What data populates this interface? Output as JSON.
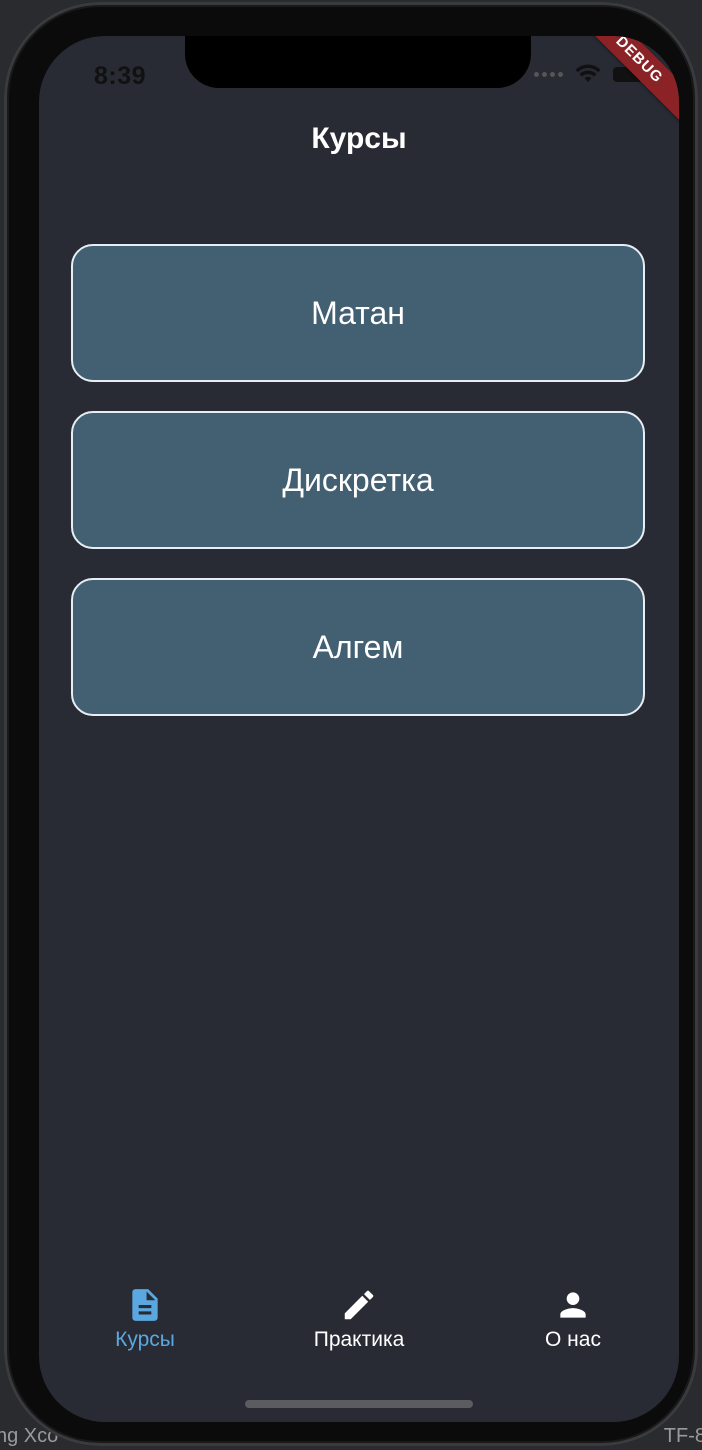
{
  "host": {
    "left_text": "ng Xco",
    "right_text": "TF-8"
  },
  "status_bar": {
    "time": "8:39",
    "debug_label": "DEBUG"
  },
  "app": {
    "title": "Курсы"
  },
  "courses": [
    {
      "label": "Матан"
    },
    {
      "label": "Дискретка"
    },
    {
      "label": "Алгем"
    }
  ],
  "bottom_nav": {
    "items": [
      {
        "label": "Курсы",
        "icon": "document-icon",
        "active": true
      },
      {
        "label": "Практика",
        "icon": "pencil-icon",
        "active": false
      },
      {
        "label": "О нас",
        "icon": "person-icon",
        "active": false
      }
    ]
  },
  "colors": {
    "background": "#282b34",
    "card": "#435f72",
    "card_border": "#e7eef3",
    "active_tab": "#5ba7df",
    "debug_ribbon": "#8b2226"
  }
}
